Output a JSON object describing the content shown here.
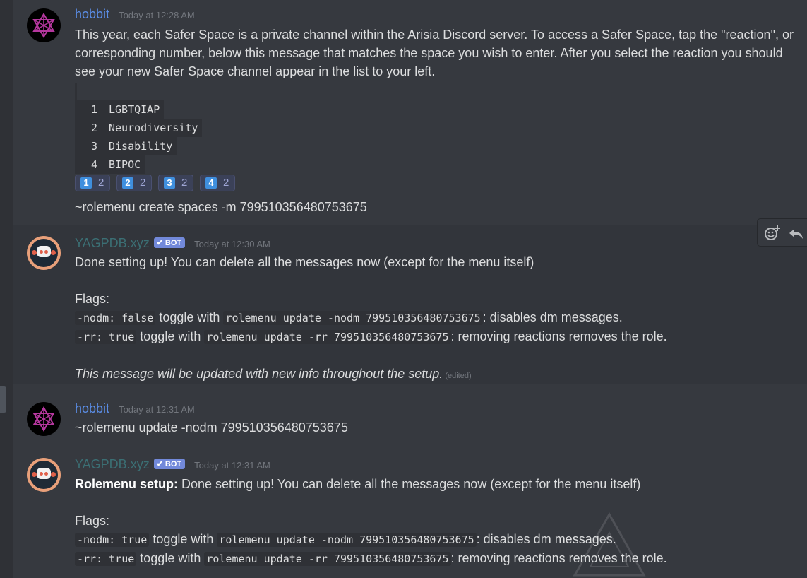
{
  "messages": [
    {
      "author": "hobbit",
      "timestamp": "Today at 12:28 AM",
      "text_lines": [
        "This year, each Safer Space is a private channel within the Arisia Discord server.  To access a Safer Space, tap the \"reaction\", or",
        "corresponding number, below this message that matches the space you wish to enter.  After you select the reaction you should",
        "see your new Safer Space channel appear in the list to your left."
      ],
      "code_rows": [
        {
          "num": "1",
          "label": "LGBTQIAP"
        },
        {
          "num": "2",
          "label": "Neurodiversity"
        },
        {
          "num": "3",
          "label": "Disability"
        },
        {
          "num": "4",
          "label": "BIPOC"
        }
      ],
      "reactions": [
        {
          "emoji": "1",
          "count": "2"
        },
        {
          "emoji": "2",
          "count": "2"
        },
        {
          "emoji": "3",
          "count": "2"
        },
        {
          "emoji": "4",
          "count": "2"
        }
      ],
      "command": "~rolemenu create spaces -m 799510356480753675"
    },
    {
      "author": "YAGPDB.xyz",
      "badge": "BOT",
      "timestamp": "Today at 12:30 AM",
      "line1": "Done setting up! You can delete all the messages now (except for the menu itself)",
      "flags_label": "Flags:",
      "flag1": {
        "code": "-nodm: false",
        "mid": " toggle with ",
        "cmd": "rolemenu update -nodm 799510356480753675",
        "desc": ": disables dm messages."
      },
      "flag2": {
        "code": "-rr: true",
        "mid": " toggle with ",
        "cmd": "rolemenu update -rr 799510356480753675",
        "desc": ": removing reactions removes the role."
      },
      "footer": "This message will be updated with new info throughout the setup.",
      "edited": "(edited)"
    },
    {
      "author": "hobbit",
      "timestamp": "Today at 12:31 AM",
      "text": "~rolemenu update -nodm 799510356480753675"
    },
    {
      "author": "YAGPDB.xyz",
      "badge": "BOT",
      "timestamp": "Today at 12:31 AM",
      "bold_prefix": "Rolemenu setup:",
      "line1": " Done setting up! You can delete all the messages now (except for the menu itself)",
      "flags_label": "Flags:",
      "flag1": {
        "code": "-nodm: true",
        "mid": " toggle with ",
        "cmd": "rolemenu update -nodm 799510356480753675",
        "desc": ": disables dm messages."
      },
      "flag2": {
        "code": "-rr: true",
        "mid": " toggle with ",
        "cmd": "rolemenu update -rr 799510356480753675",
        "desc": ": removing reactions removes the role."
      }
    }
  ],
  "colors": {
    "background": "#36393f",
    "hobbit_name": "#5b8ee8",
    "bot_name": "#3b6f74",
    "bot_badge": "#7289da"
  },
  "icons": [
    "hexagram-avatar",
    "robot-avatar",
    "add-reaction-icon",
    "reply-icon",
    "verified-check-icon"
  ]
}
